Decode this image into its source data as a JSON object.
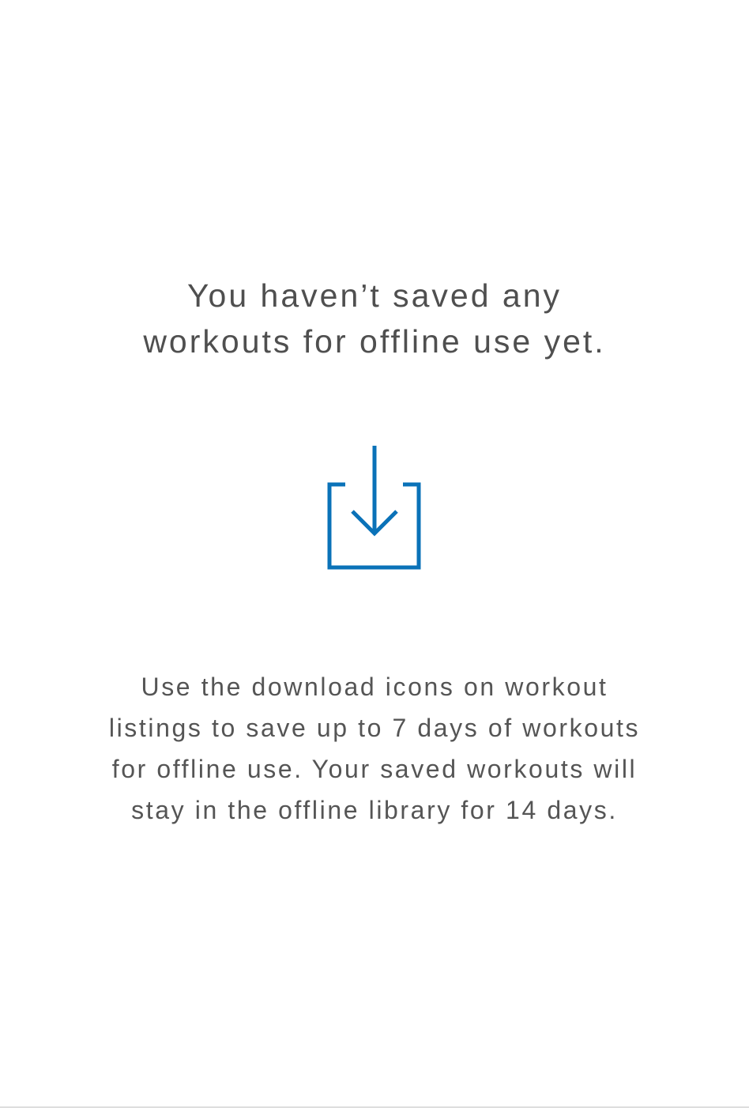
{
  "empty_state": {
    "title_lines": [
      "You haven’t saved any",
      "workouts for offline use yet."
    ],
    "icon": "download-icon",
    "description_lines": [
      "Use the download icons on workout",
      "listings to save up to 7 days of workouts",
      "for offline use. Your saved workouts will",
      "stay in the offline library for 14 days."
    ]
  },
  "colors": {
    "accent": "#0a72b8",
    "text": "#505050",
    "background": "#ffffff"
  }
}
